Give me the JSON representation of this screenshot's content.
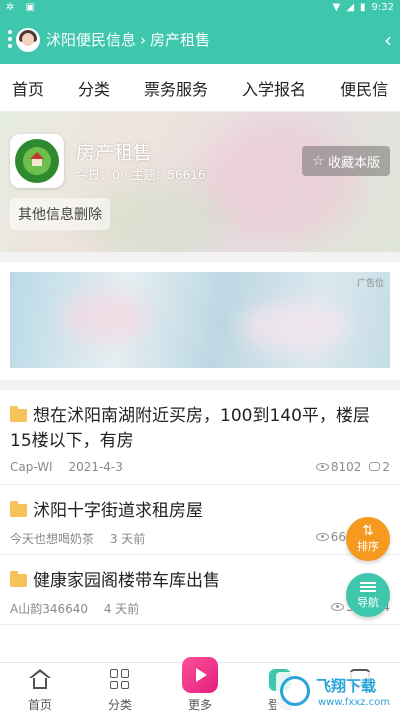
{
  "status_bar": {
    "left_icons": [
      "settings-icon",
      "a-icon"
    ],
    "time": "9:32"
  },
  "navbar": {
    "breadcrumb": [
      "沭阳便民信息",
      "房产租售"
    ],
    "separator": "›"
  },
  "tabs": [
    "首页",
    "分类",
    "票务服务",
    "入学报名",
    "便民信"
  ],
  "forum": {
    "title": "房产租售",
    "today_label": "今日：",
    "today_count": "0",
    "topics_label": "主题：",
    "topics_count": "56616",
    "favorite_label": "收藏本版",
    "delete_label": "其他信息删除"
  },
  "ad": {
    "label": "广告位"
  },
  "posts": [
    {
      "title": "想在沭阳南湖附近买房，100到140平，楼层15楼以下，有房",
      "author": "Cap-WI",
      "time": "2021-4-3",
      "views": "8102",
      "replies": "2"
    },
    {
      "title": "沭阳十字街道求租房屋",
      "author": "今天也想喝奶茶",
      "time": "3 天前",
      "views": "66",
      "replies": ""
    },
    {
      "title": "健康家园阁楼带车库出售",
      "author": "A山韵346640",
      "time": "4 天前",
      "views": "37",
      "replies": "4"
    }
  ],
  "fabs": {
    "sort_label": "排序",
    "nav_label": "导航"
  },
  "tabbar": {
    "home": "首页",
    "category": "分类",
    "more": "更多",
    "login": "登陆"
  },
  "watermark": {
    "title": "飞翔下载",
    "url": "www.fxxz.com"
  },
  "colors": {
    "primary": "#3ec7ad",
    "sort_fab": "#f59a1e",
    "folder": "#f5c35a"
  }
}
